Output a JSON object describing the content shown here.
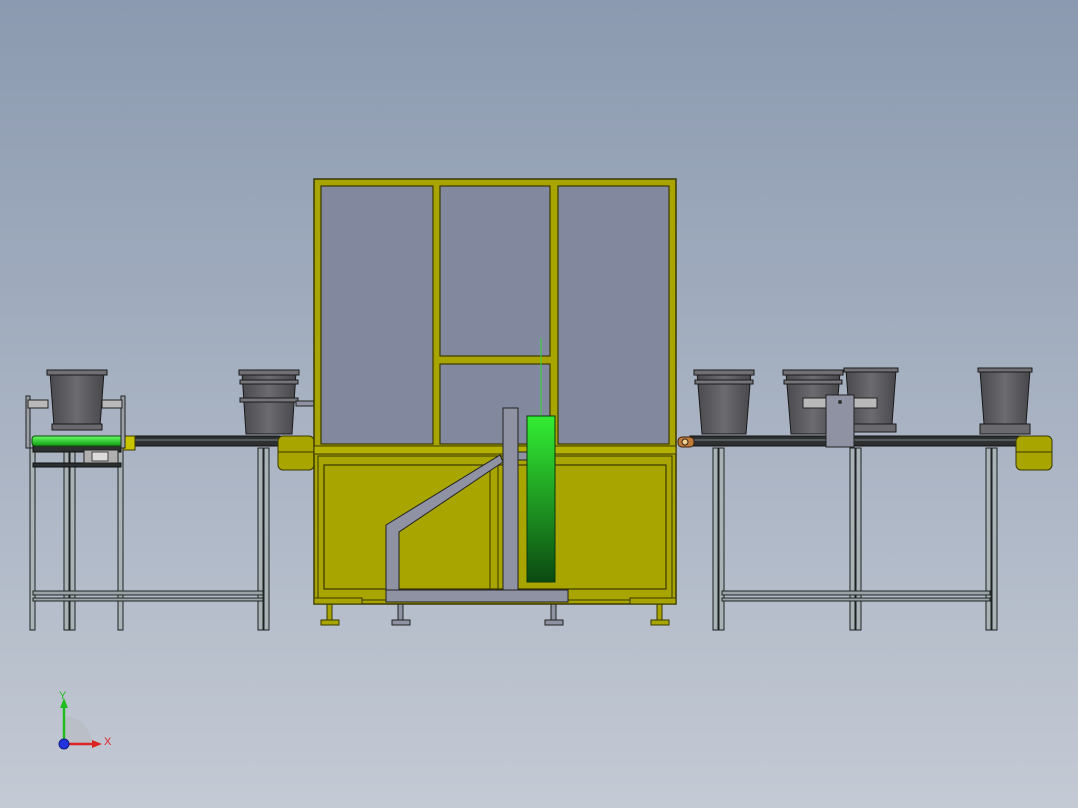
{
  "axes": {
    "y_label": "Y",
    "x_label": "X",
    "colors": {
      "y": "#22bb22",
      "x": "#dd2222",
      "z": "#2233dd"
    }
  },
  "colors": {
    "frame_yellow": "#a8a400",
    "frame_edge": "#3a3800",
    "glass_panel": "#82889e",
    "bucket": "#5c5c60",
    "conveyor_rail": "#2c3030",
    "leg_steel": "#9aa4a6",
    "green_part": "#33dd33",
    "bracket_gray": "#8e92a2"
  }
}
